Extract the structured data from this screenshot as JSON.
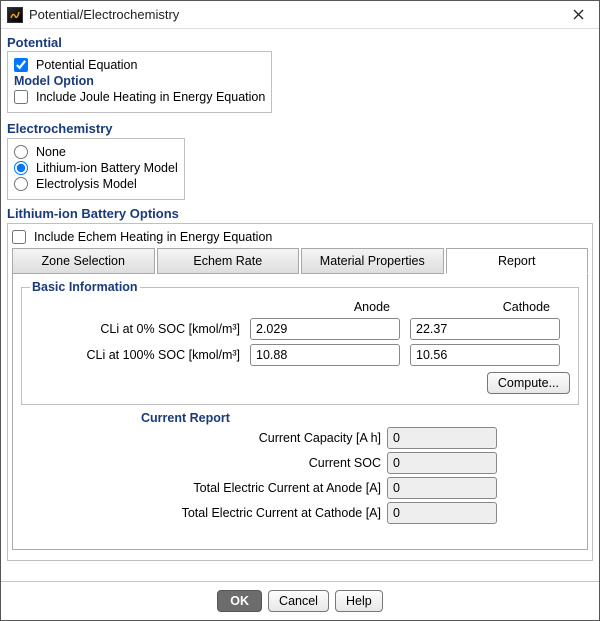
{
  "window": {
    "title": "Potential/Electrochemistry"
  },
  "potential": {
    "heading": "Potential",
    "eq_label": "Potential Equation",
    "eq_checked": true,
    "model_option_heading": "Model Option",
    "joule_label": "Include Joule Heating in Energy Equation",
    "joule_checked": false
  },
  "electrochemistry": {
    "heading": "Electrochemistry",
    "none_label": "None",
    "lib_label": "Lithium-ion Battery Model",
    "elec_label": "Electrolysis Model",
    "selected": "lib"
  },
  "libo": {
    "heading": "Lithium-ion Battery Options",
    "echem_heat_label": "Include Echem Heating in Energy Equation",
    "echem_heat_checked": false,
    "tabs": {
      "zone": "Zone Selection",
      "rate": "Echem Rate",
      "mat": "Material Properties",
      "report": "Report"
    },
    "active_tab": "report"
  },
  "basic": {
    "legend": "Basic Information",
    "col_anode": "Anode",
    "col_cathode": "Cathode",
    "soc0_label": "CLi at 0% SOC [kmol/m³]",
    "soc0_anode": "2.029",
    "soc0_cathode": "22.37",
    "soc100_label": "CLi at 100% SOC [kmol/m³]",
    "soc100_anode": "10.88",
    "soc100_cathode": "10.56",
    "compute_label": "Compute..."
  },
  "current_report": {
    "heading": "Current Report",
    "capacity_label": "Current Capacity [A h]",
    "capacity_value": "0",
    "soc_label": "Current SOC",
    "soc_value": "0",
    "anode_label": "Total Electric Current at Anode [A]",
    "anode_value": "0",
    "cathode_label": "Total Electric Current at Cathode [A]",
    "cathode_value": "0"
  },
  "footer": {
    "ok": "OK",
    "cancel": "Cancel",
    "help": "Help"
  }
}
